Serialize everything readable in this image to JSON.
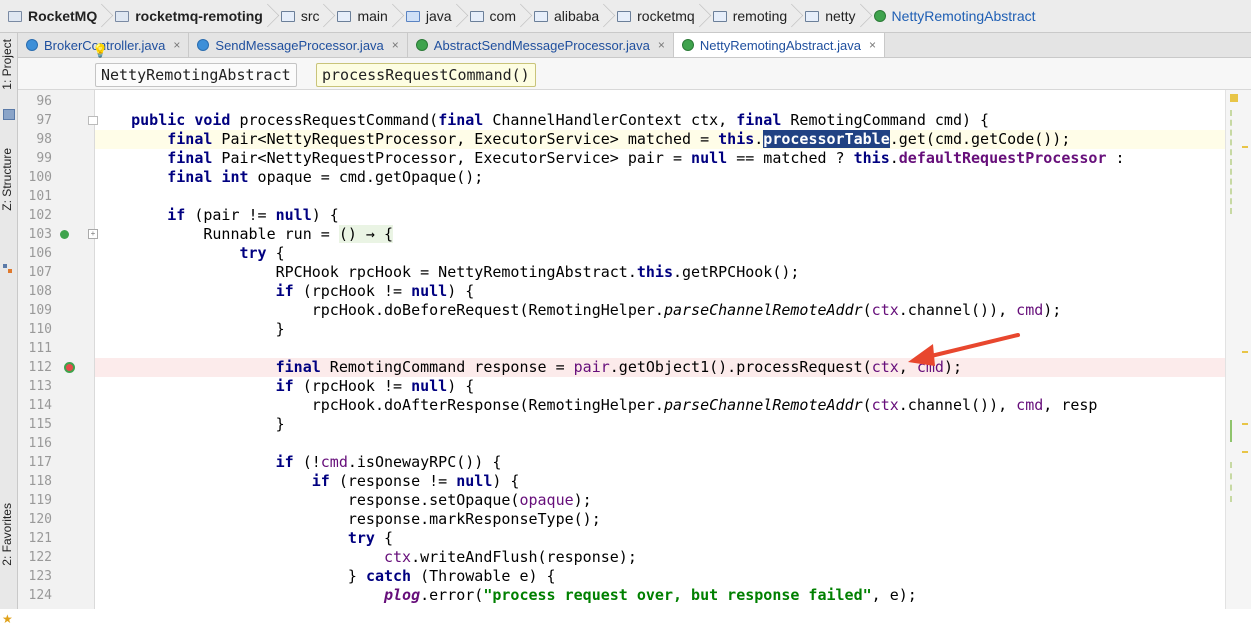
{
  "breadcrumb": [
    {
      "label": "RocketMQ",
      "icon": "module-folder-icon",
      "bold": true
    },
    {
      "label": "rocketmq-remoting",
      "icon": "module-folder-icon",
      "bold": true
    },
    {
      "label": "src",
      "icon": "folder-icon",
      "bold": false
    },
    {
      "label": "main",
      "icon": "folder-icon",
      "bold": false
    },
    {
      "label": "java",
      "icon": "source-folder-icon",
      "bold": false
    },
    {
      "label": "com",
      "icon": "package-icon",
      "bold": false
    },
    {
      "label": "alibaba",
      "icon": "package-icon",
      "bold": false
    },
    {
      "label": "rocketmq",
      "icon": "package-icon",
      "bold": false
    },
    {
      "label": "remoting",
      "icon": "package-icon",
      "bold": false
    },
    {
      "label": "netty",
      "icon": "package-icon",
      "bold": false
    },
    {
      "label": "NettyRemotingAbstract",
      "icon": "abstract-class-icon",
      "bold": false
    }
  ],
  "tool_windows": {
    "project": "1: Project",
    "structure": "Z: Structure",
    "favorites": "2: Favorites"
  },
  "tabs": [
    {
      "label": "BrokerController.java",
      "icon": "class-icon",
      "active": false
    },
    {
      "label": "SendMessageProcessor.java",
      "icon": "class-icon",
      "active": false
    },
    {
      "label": "AbstractSendMessageProcessor.java",
      "icon": "abstract-class-icon",
      "active": false
    },
    {
      "label": "NettyRemotingAbstract.java",
      "icon": "abstract-class-icon",
      "active": true
    }
  ],
  "tab_close_glyph": "×",
  "structure_breadcrumb": {
    "class_name": "NettyRemotingAbstract",
    "method_name": "processRequestCommand()"
  },
  "code": {
    "line_numbers": [
      "96",
      "97",
      "98",
      "99",
      "100",
      "101",
      "102",
      "103",
      "106",
      "107",
      "108",
      "109",
      "110",
      "111",
      "112",
      "113",
      "114",
      "115",
      "116",
      "117",
      "118",
      "119",
      "120",
      "121",
      "122",
      "123",
      "124"
    ],
    "lines": [
      "",
      "    <k>public</k> <k>void</k> processRequestCommand(<k>final</k> ChannelHandlerContext ctx, <k>final</k> RemotingCommand cmd) {",
      "        <k>final</k> Pair&lt;NettyRequestProcessor, ExecutorService&gt; matched = <k>this</k>.<s>processorTable</s>.get(cmd.getCode());",
      "        <k>final</k> Pair&lt;NettyRequestProcessor, ExecutorService&gt; pair = <k>null</k> == matched ? <k>this</k>.<f>defaultRequestProcessor</f> :",
      "        <k>final</k> <k>int</k> opaque = cmd.getOpaque();",
      "",
      "        <k>if</k> (pair != <k>null</k>) {",
      "            Runnable run = <l>() &rarr; {</l>",
      "                <k>try</k> {",
      "                    RPCHook rpcHook = NettyRemotingAbstract.<k>this</k>.getRPCHook();",
      "                    <k>if</k> (rpcHook != <k>null</k>) {",
      "                        rpcHook.doBeforeRequest(RemotingHelper.<i>parseChannelRemoteAddr</i>(<v>ctx</v>.channel()), <v>cmd</v>);",
      "                    }",
      "",
      "                    <k>final</k> RemotingCommand response = <v>pair</v>.getObject1().processRequest(<v>ctx</v>, <v>cmd</v>);",
      "                    <k>if</k> (rpcHook != <k>null</k>) {",
      "                        rpcHook.doAfterResponse(RemotingHelper.<i>parseChannelRemoteAddr</i>(<v>ctx</v>.channel()), <v>cmd</v>, resp",
      "                    }",
      "",
      "                    <k>if</k> (!<v>cmd</v>.isOnewayRPC()) {",
      "                        <k>if</k> (response != <k>null</k>) {",
      "                            response.setOpaque(<v>opaque</v>);",
      "                            response.markResponseType();",
      "                            <k>try</k> {",
      "                                <v>ctx</v>.writeAndFlush(response);",
      "                            } <k>catch</k> (Throwable e) {",
      "                                <fi>plog</fi>.error(<str>\"process request over, but response failed\"</str>, e);"
    ],
    "highlighted_line": "98",
    "breakpoint_line": "112",
    "override_line": "103"
  },
  "colors": {
    "keyword": "#000080",
    "field": "#660e7a",
    "string": "#008000",
    "selection": "#214283",
    "breakpoint_line_bg": "#fcebeb",
    "annotation_arrow": "#e8472e"
  }
}
